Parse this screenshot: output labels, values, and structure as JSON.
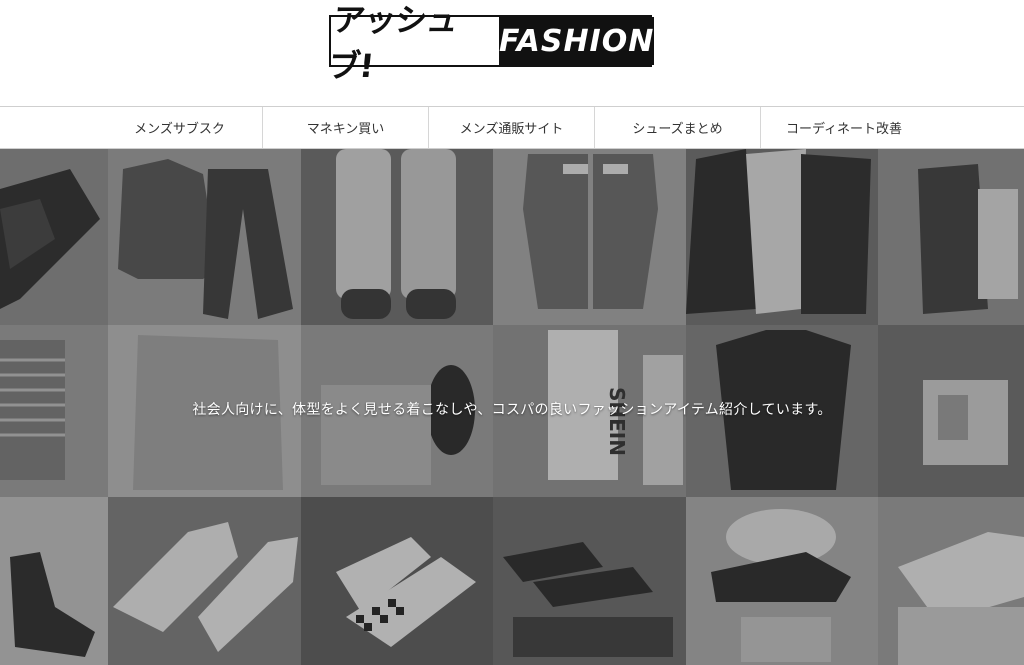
{
  "logo": {
    "jp": "アッシュブ!",
    "en": "FASHION"
  },
  "nav": [
    {
      "label": "メンズサブスク"
    },
    {
      "label": "マネキン買い"
    },
    {
      "label": "メンズ通販サイト"
    },
    {
      "label": "シューズまとめ"
    },
    {
      "label": "コーディネート改善"
    }
  ],
  "hero": {
    "tagline": "社会人向けに、体型をよく見せる着こなしや、コスパの良いファッションアイテム紹介しています。",
    "bag_print": "SHEIN"
  }
}
